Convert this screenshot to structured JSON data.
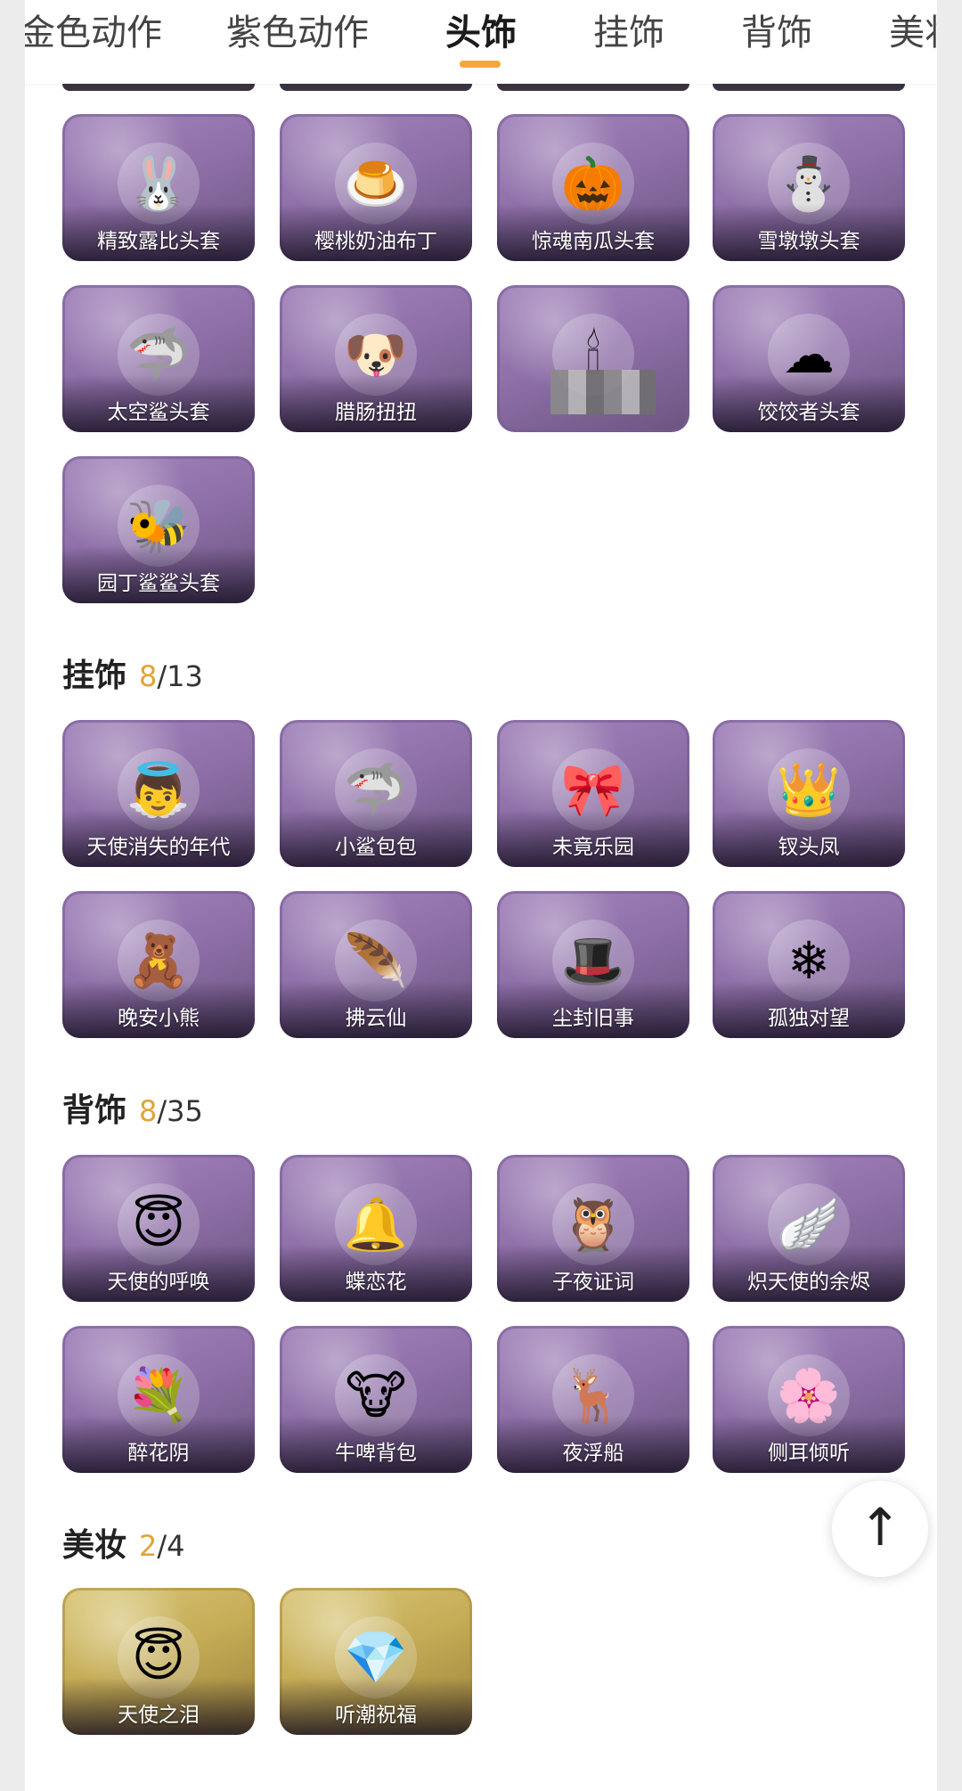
{
  "tabs": [
    {
      "label": "金色动作",
      "active": false
    },
    {
      "label": "紫色动作",
      "active": false
    },
    {
      "label": "头饰",
      "active": true
    },
    {
      "label": "挂饰",
      "active": false
    },
    {
      "label": "背饰",
      "active": false
    },
    {
      "label": "美妆",
      "active": false
    }
  ],
  "colors": {
    "accent": "#f3a83b",
    "owned_count": "#e2a33a",
    "tile_purple": "#8f70a9",
    "tile_gold": "#c5ac56"
  },
  "headwear": {
    "items": [
      {
        "label": "精致露比头套",
        "icon": "pink-bunny-head-icon",
        "glyph": "🐰"
      },
      {
        "label": "樱桃奶油布丁",
        "icon": "pudding-icon",
        "glyph": "🍮"
      },
      {
        "label": "惊魂南瓜头套",
        "icon": "pumpkin-icon",
        "glyph": "🎃"
      },
      {
        "label": "雪墩墩头套",
        "icon": "snowman-icon",
        "glyph": "⛄"
      },
      {
        "label": "太空鲨头套",
        "icon": "shark-head-icon",
        "glyph": "🦈"
      },
      {
        "label": "腊肠扭扭",
        "icon": "dog-head-icon",
        "glyph": "🐶"
      },
      {
        "label": "",
        "icon": "candle-icon",
        "glyph": "🕯"
      },
      {
        "label": "饺饺者头套",
        "icon": "cloud-head-icon",
        "glyph": "☁"
      },
      {
        "label": "园丁鲨鲨头套",
        "icon": "bee-shark-icon",
        "glyph": "🐝"
      }
    ]
  },
  "pendants": {
    "title": "挂饰",
    "owned": "8",
    "total": "/13",
    "items": [
      {
        "label": "天使消失的年代",
        "icon": "angel-figure-icon",
        "glyph": "👼"
      },
      {
        "label": "小鲨包包",
        "icon": "shark-bag-icon",
        "glyph": "🦈"
      },
      {
        "label": "未竟乐园",
        "icon": "pink-doll-icon",
        "glyph": "🎀"
      },
      {
        "label": "钗头凤",
        "icon": "phoenix-crown-icon",
        "glyph": "👑"
      },
      {
        "label": "晚安小熊",
        "icon": "bear-icon",
        "glyph": "🧸"
      },
      {
        "label": "拂云仙",
        "icon": "fairy-pendant-icon",
        "glyph": "🪶"
      },
      {
        "label": "尘封旧事",
        "icon": "gentleman-doll-icon",
        "glyph": "🎩"
      },
      {
        "label": "孤独对望",
        "icon": "white-doll-icon",
        "glyph": "❄"
      }
    ]
  },
  "back_items": {
    "title": "背饰",
    "owned": "8",
    "total": "/35",
    "items": [
      {
        "label": "天使的呼唤",
        "icon": "angel-child-icon",
        "glyph": "😇"
      },
      {
        "label": "蝶恋花",
        "icon": "bell-butterfly-icon",
        "glyph": "🔔"
      },
      {
        "label": "子夜证词",
        "icon": "owl-icon",
        "glyph": "🦉"
      },
      {
        "label": "炽天使的余烬",
        "icon": "winged-girl-icon",
        "glyph": "🪽"
      },
      {
        "label": "醉花阴",
        "icon": "floral-wreath-icon",
        "glyph": "💐"
      },
      {
        "label": "牛啤背包",
        "icon": "cow-backpack-icon",
        "glyph": "🐮"
      },
      {
        "label": "夜浮船",
        "icon": "ice-antlers-icon",
        "glyph": "🦌"
      },
      {
        "label": "侧耳倾听",
        "icon": "lotus-moon-icon",
        "glyph": "🌸"
      }
    ]
  },
  "makeup": {
    "title": "美妆",
    "owned": "2",
    "total": "/4",
    "items": [
      {
        "label": "天使之泪",
        "icon": "halo-face-icon",
        "glyph": "😇"
      },
      {
        "label": "听潮祝福",
        "icon": "crystal-face-icon",
        "glyph": "💎"
      }
    ]
  },
  "scroll_top": {
    "glyph": "↑"
  }
}
